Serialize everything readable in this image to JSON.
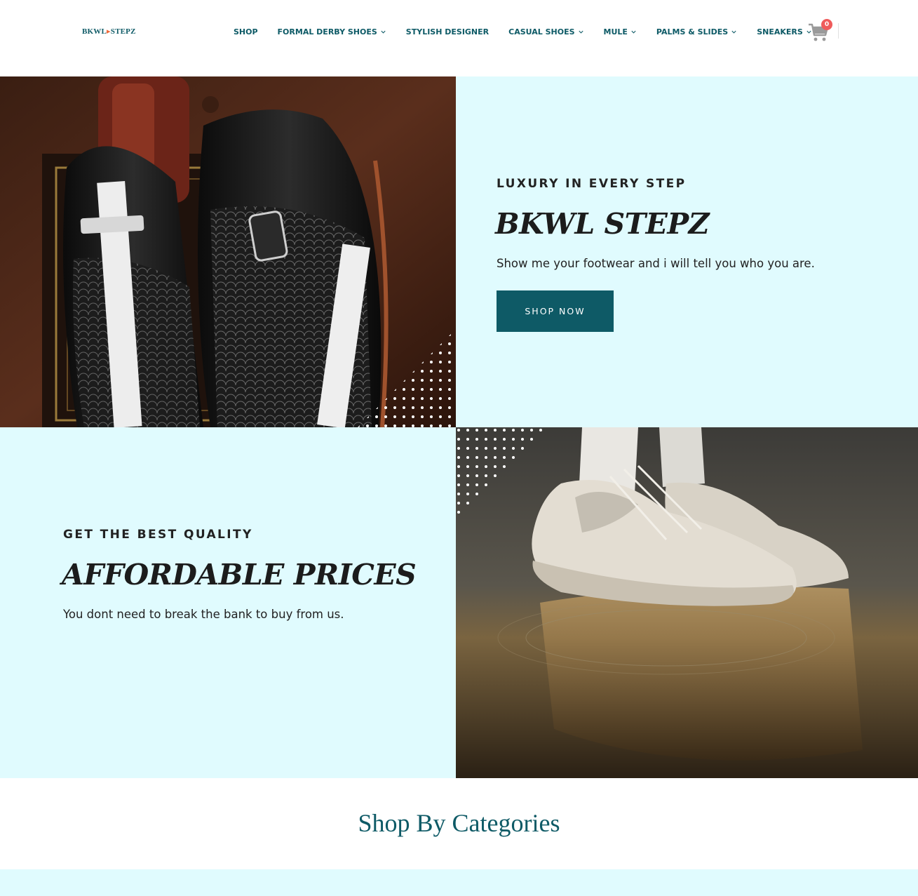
{
  "header": {
    "logo": {
      "part1": "BKWL",
      "part2": "STEPZ"
    },
    "nav": [
      {
        "label": "SHOP",
        "dropdown": false
      },
      {
        "label": "FORMAL DERBY SHOES",
        "dropdown": true
      },
      {
        "label": "STYLISH DESIGNER",
        "dropdown": false
      },
      {
        "label": "CASUAL SHOES",
        "dropdown": true
      },
      {
        "label": "MULE",
        "dropdown": true
      },
      {
        "label": "PALMS & SLIDES",
        "dropdown": true
      },
      {
        "label": "SNEAKERS",
        "dropdown": true
      }
    ],
    "cart": {
      "icon": "shopping-cart-icon",
      "count": "0"
    }
  },
  "hero": {
    "eyebrow": "LUXURY IN EVERY STEP",
    "title": "BKWL STEPZ",
    "text": "Show me your footwear and i will tell you who you are.",
    "button": "SHOP NOW"
  },
  "feature": {
    "eyebrow": "GET THE BEST QUALITY",
    "title": "AFFORDABLE PRICES",
    "text": "You dont need to break the bank to buy from us."
  },
  "categories": {
    "title": "Shop By Categories"
  },
  "colors": {
    "brand": "#0e5a66",
    "panel_bg": "#e0fbfe",
    "badge": "#ef5b5b",
    "logo_accent": "#f06a3b"
  }
}
